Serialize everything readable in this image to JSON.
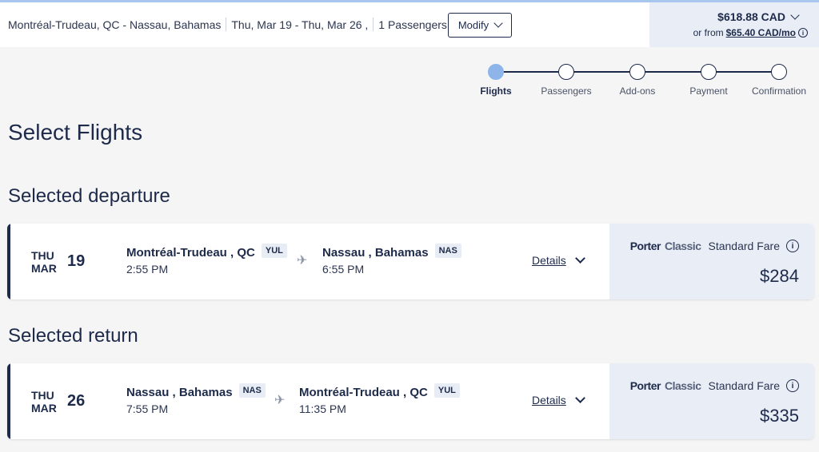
{
  "header": {
    "trip_route": "Montréal-Trudeau, QC - Nassau, Bahamas",
    "trip_dates": "Thu, Mar 19 - Thu, Mar 26 ,",
    "trip_passengers": "1 Passengers",
    "modify_label": "Modify",
    "total_price": "$618.88 CAD",
    "or_from_label": "or from",
    "monthly_price": "$65.40 CAD/mo"
  },
  "stepper": {
    "steps": [
      {
        "label": "Flights",
        "active": true
      },
      {
        "label": "Passengers",
        "active": false
      },
      {
        "label": "Add-ons",
        "active": false
      },
      {
        "label": "Payment",
        "active": false
      },
      {
        "label": "Confirmation",
        "active": false
      }
    ]
  },
  "page_title": "Select Flights",
  "departure": {
    "section_title": "Selected departure",
    "dow": "THU",
    "month": "MAR",
    "day": "19",
    "origin_city": "Montréal-Trudeau , QC",
    "origin_code": "YUL",
    "depart_time": "2:55 PM",
    "dest_city": "Nassau , Bahamas",
    "dest_code": "NAS",
    "arrive_time": "6:55 PM",
    "details_label": "Details",
    "fare_brand_1": "Porter",
    "fare_brand_2": "Classic",
    "fare_type": "Standard Fare",
    "price": "$284"
  },
  "return": {
    "section_title": "Selected return",
    "dow": "THU",
    "month": "MAR",
    "day": "26",
    "origin_city": "Nassau , Bahamas",
    "origin_code": "NAS",
    "depart_time": "7:55 PM",
    "dest_city": "Montréal-Trudeau , QC",
    "dest_code": "YUL",
    "arrive_time": "11:35 PM",
    "details_label": "Details",
    "fare_brand_1": "Porter",
    "fare_brand_2": "Classic",
    "fare_type": "Standard Fare",
    "price": "$335"
  },
  "icons": {
    "plane": "airplane-icon",
    "info": "info-icon",
    "chevron": "chevron-down-icon"
  },
  "colors": {
    "navy": "#1d2a4a",
    "active_step": "#8db5ea",
    "fare_panel": "#e9eef6"
  }
}
